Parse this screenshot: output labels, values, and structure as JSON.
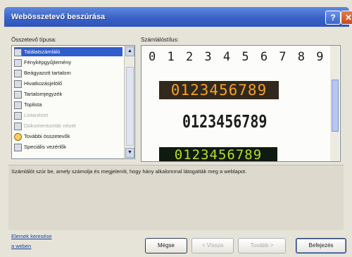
{
  "window": {
    "title": "Webösszetevő beszúrása",
    "help_glyph": "?",
    "close_glyph": "✕"
  },
  "left": {
    "label": "Összetevő típusa:",
    "items": [
      {
        "label": "Találatszámláló",
        "icon": "hit-counter-icon",
        "selected": true
      },
      {
        "label": "Fényképgyűjtemény",
        "icon": "photo-gallery-icon"
      },
      {
        "label": "Beágyazott tartalom",
        "icon": "included-content-icon"
      },
      {
        "label": "Hivatkozásjelölő",
        "icon": "link-bar-icon"
      },
      {
        "label": "Tartalomjegyzék",
        "icon": "table-of-contents-icon"
      },
      {
        "label": "Toplista",
        "icon": "top-ten-list-icon"
      },
      {
        "label": "Listanézet",
        "icon": "list-view-icon",
        "disabled": true
      },
      {
        "label": "Dokumentumtár nézet",
        "icon": "document-library-view-icon",
        "disabled": true
      },
      {
        "label": "További összetevők",
        "icon": "additional-components-icon"
      },
      {
        "label": "Speciális vezérlők",
        "icon": "advanced-controls-icon"
      }
    ]
  },
  "right": {
    "label": "Számlálóstílus:",
    "styles": [
      {
        "digits": "0 1 2 3 4 5 6 7 8 9"
      },
      {
        "digits": "0123456789"
      },
      {
        "digits": "0123456789"
      },
      {
        "digits": "0123456789"
      }
    ]
  },
  "description": "Számlálót szúr be, amely számolja és megjeleníti, hogy hány alkalommal látogatták meg a weblapot.",
  "links": {
    "find_more": "Elemek keresése",
    "on_web": "a weben"
  },
  "buttons": {
    "cancel": "Mégse",
    "back": "< Vissza",
    "next": "Tovább >",
    "finish": "Befejezés"
  },
  "colors": {
    "titlebar": "#3a62c8",
    "selection": "#2f5dcb",
    "counter_orange": "#f2a02a",
    "counter_green": "#b8dd2a"
  }
}
